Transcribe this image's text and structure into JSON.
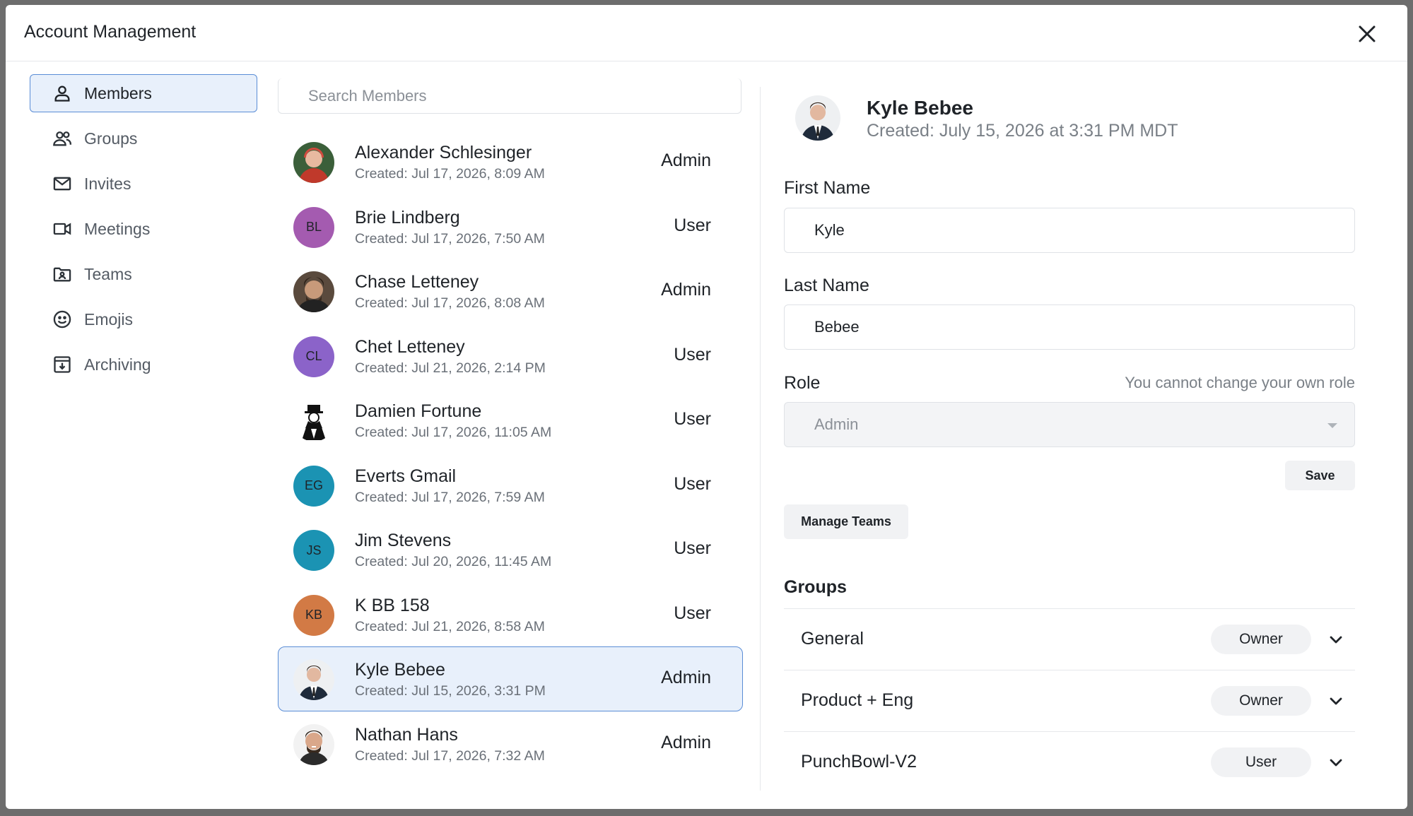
{
  "modal": {
    "title": "Account Management",
    "close_icon": "close-icon"
  },
  "sidebar": {
    "items": [
      {
        "label": "Members",
        "icon": "user-icon",
        "active": true
      },
      {
        "label": "Groups",
        "icon": "users-icon",
        "active": false
      },
      {
        "label": "Invites",
        "icon": "mail-icon",
        "active": false
      },
      {
        "label": "Meetings",
        "icon": "video-icon",
        "active": false
      },
      {
        "label": "Teams",
        "icon": "folder-user-icon",
        "active": false
      },
      {
        "label": "Emojis",
        "icon": "smile-icon",
        "active": false
      },
      {
        "label": "Archiving",
        "icon": "archive-icon",
        "active": false
      }
    ]
  },
  "members": {
    "search_placeholder": "Search Members",
    "list": [
      {
        "name": "Alexander Schlesinger",
        "created": "Created: Jul 17, 2026, 8:09 AM",
        "role": "Admin",
        "avatar": "photo",
        "initials": "",
        "color": "#b73a3a"
      },
      {
        "name": "Brie Lindberg",
        "created": "Created: Jul 17, 2026, 7:50 AM",
        "role": "User",
        "avatar": "initials",
        "initials": "BL",
        "color": "#a45bb0"
      },
      {
        "name": "Chase Letteney",
        "created": "Created: Jul 17, 2026, 8:08 AM",
        "role": "Admin",
        "avatar": "photo",
        "initials": "",
        "color": "#4a3b30"
      },
      {
        "name": "Chet Letteney",
        "created": "Created: Jul 21, 2026, 2:14 PM",
        "role": "User",
        "avatar": "initials",
        "initials": "CL",
        "color": "#8b63c9"
      },
      {
        "name": "Damien Fortune",
        "created": "Created: Jul 17, 2026, 11:05 AM",
        "role": "User",
        "avatar": "photo",
        "initials": "",
        "color": "#2a2a2a"
      },
      {
        "name": "Everts Gmail",
        "created": "Created: Jul 17, 2026, 7:59 AM",
        "role": "User",
        "avatar": "initials",
        "initials": "EG",
        "color": "#1b93b3"
      },
      {
        "name": "Jim Stevens",
        "created": "Created: Jul 20, 2026, 11:45 AM",
        "role": "User",
        "avatar": "initials",
        "initials": "JS",
        "color": "#1b93b3"
      },
      {
        "name": "K BB 158",
        "created": "Created: Jul 21, 2026, 8:58 AM",
        "role": "User",
        "avatar": "initials",
        "initials": "KB",
        "color": "#d27a45"
      },
      {
        "name": "Kyle Bebee",
        "created": "Created: Jul 15, 2026, 3:31 PM",
        "role": "Admin",
        "avatar": "photo",
        "initials": "",
        "color": "#2b3a4f",
        "selected": true
      },
      {
        "name": "Nathan Hans",
        "created": "Created: Jul 17, 2026, 7:32 AM",
        "role": "Admin",
        "avatar": "photo",
        "initials": "",
        "color": "#3e2f25"
      }
    ]
  },
  "detail": {
    "name": "Kyle Bebee",
    "created": "Created: July 15, 2026 at 3:31 PM MDT",
    "first_name_label": "First Name",
    "first_name_value": "Kyle",
    "last_name_label": "Last Name",
    "last_name_value": "Bebee",
    "role_label": "Role",
    "role_note": "You cannot change your own role",
    "role_value": "Admin",
    "save_label": "Save",
    "manage_teams_label": "Manage Teams",
    "groups_title": "Groups",
    "groups": [
      {
        "name": "General",
        "role": "Owner"
      },
      {
        "name": "Product + Eng",
        "role": "Owner"
      },
      {
        "name": "PunchBowl-V2",
        "role": "User"
      }
    ]
  }
}
